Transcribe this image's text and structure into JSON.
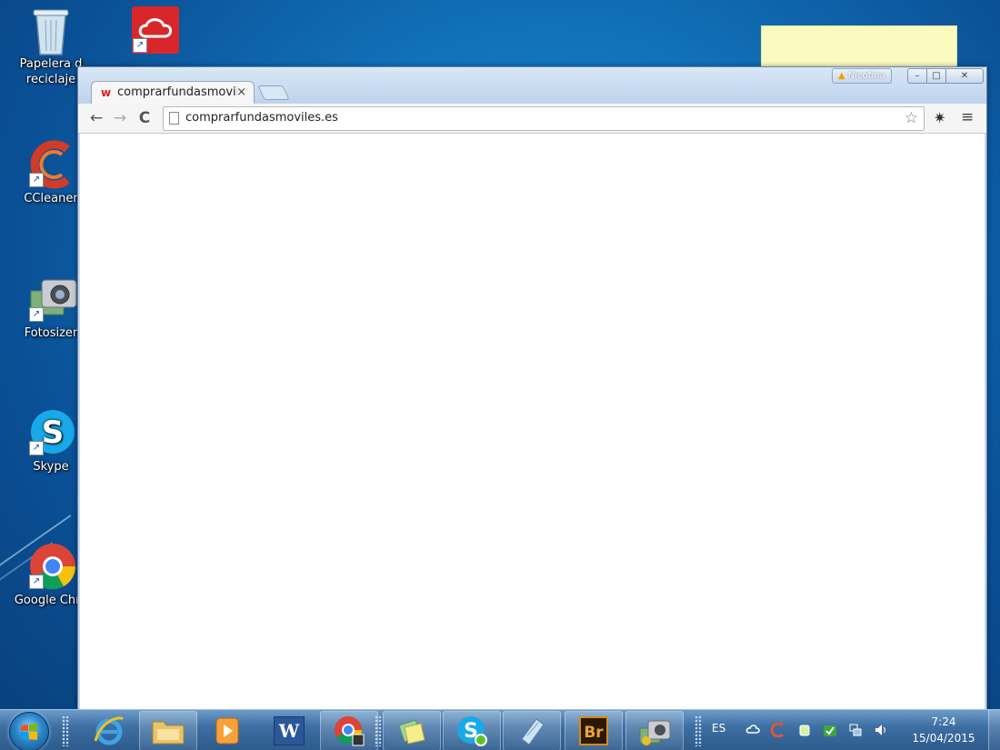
{
  "desktop": {
    "icons": [
      {
        "label_line1": "Papelera d",
        "label_line2": "reciclaje"
      },
      {
        "label_line1": "CCleaner"
      },
      {
        "label_line1": "Fotosizer"
      },
      {
        "label_line1": "Skype"
      },
      {
        "label_line1": "Google Chro"
      }
    ]
  },
  "browser": {
    "tab": {
      "favicon": "w",
      "title": "comprarfundasmovil",
      "close": "×"
    },
    "warning_badge": "Nicotina",
    "window_buttons": {
      "minimize": "–",
      "maximize": "□",
      "close": "✕"
    },
    "nav": {
      "back": "←",
      "forward": "→",
      "reload": "C"
    },
    "omnibox": {
      "url": "comprarfundasmoviles.es",
      "star": "☆"
    },
    "extension_icon": "✷",
    "menu_icon": "≡"
  },
  "taskbar": {
    "language": "ES",
    "clock": {
      "time": "7:24",
      "date": "15/04/2015"
    },
    "pinned": [
      "internet-explorer",
      "windows-explorer",
      "media-player",
      "word",
      "chrome",
      "sticky-notes",
      "skype",
      "notepad",
      "bridge",
      "fotosizer"
    ],
    "bridge_label": "Br",
    "word_label": "W"
  },
  "colors": {
    "desktop_blue": "#1170b8",
    "sticky_note": "#fbfbc0",
    "taskbar": "#3e6fa3"
  }
}
